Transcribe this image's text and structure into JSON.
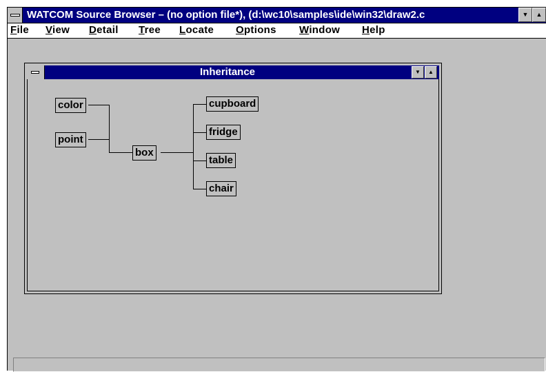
{
  "app": {
    "title": "WATCOM Source Browser – (no option file*), (d:\\wc10\\samples\\ide\\win32\\draw2.c",
    "minimize_glyph": "▼",
    "maximize_glyph": "▲"
  },
  "menu": {
    "items": [
      "File",
      "View",
      "Detail",
      "Tree",
      "Locate",
      "Options",
      "Window",
      "Help"
    ]
  },
  "inheritance_window": {
    "title": "Inheritance",
    "minimize_glyph": "▼",
    "maximize_glyph": "▲",
    "nodes": {
      "color": "color",
      "point": "point",
      "box": "box",
      "cupboard": "cupboard",
      "fridge": "fridge",
      "table": "table",
      "chair": "chair"
    }
  },
  "status": {
    "text": ""
  }
}
